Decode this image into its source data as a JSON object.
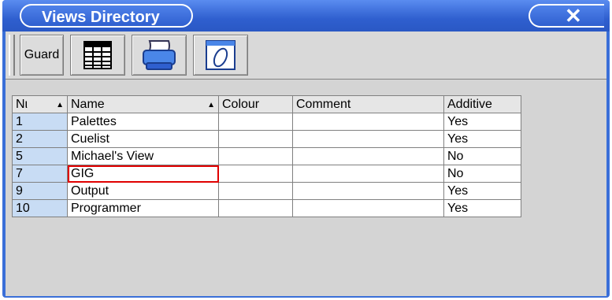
{
  "window": {
    "title": "Views Directory",
    "close_glyph": "✕"
  },
  "toolbar": {
    "guard_label": "Guard",
    "icons": [
      "grid-icon",
      "printer-icon",
      "comment-icon"
    ]
  },
  "table": {
    "headers": {
      "num": "Nι",
      "name": "Name",
      "colour": "Colour",
      "comment": "Comment",
      "additive": "Additive"
    },
    "rows": [
      {
        "num": "1",
        "name": "Palettes",
        "colour": "",
        "comment": "",
        "additive": "Yes"
      },
      {
        "num": "2",
        "name": "Cuelist",
        "colour": "",
        "comment": "",
        "additive": "Yes"
      },
      {
        "num": "5",
        "name": "Michael's View",
        "colour": "",
        "comment": "",
        "additive": "No"
      },
      {
        "num": "7",
        "name": "GIG",
        "colour": "",
        "comment": "",
        "additive": "No"
      },
      {
        "num": "9",
        "name": "Output",
        "colour": "",
        "comment": "",
        "additive": "Yes"
      },
      {
        "num": "10",
        "name": "Programmer",
        "colour": "",
        "comment": "",
        "additive": "Yes"
      }
    ]
  },
  "colors": {
    "title_bar": "#2f5fcf",
    "num_column": "#c8dcf4",
    "edit_highlight": "#e00000"
  }
}
